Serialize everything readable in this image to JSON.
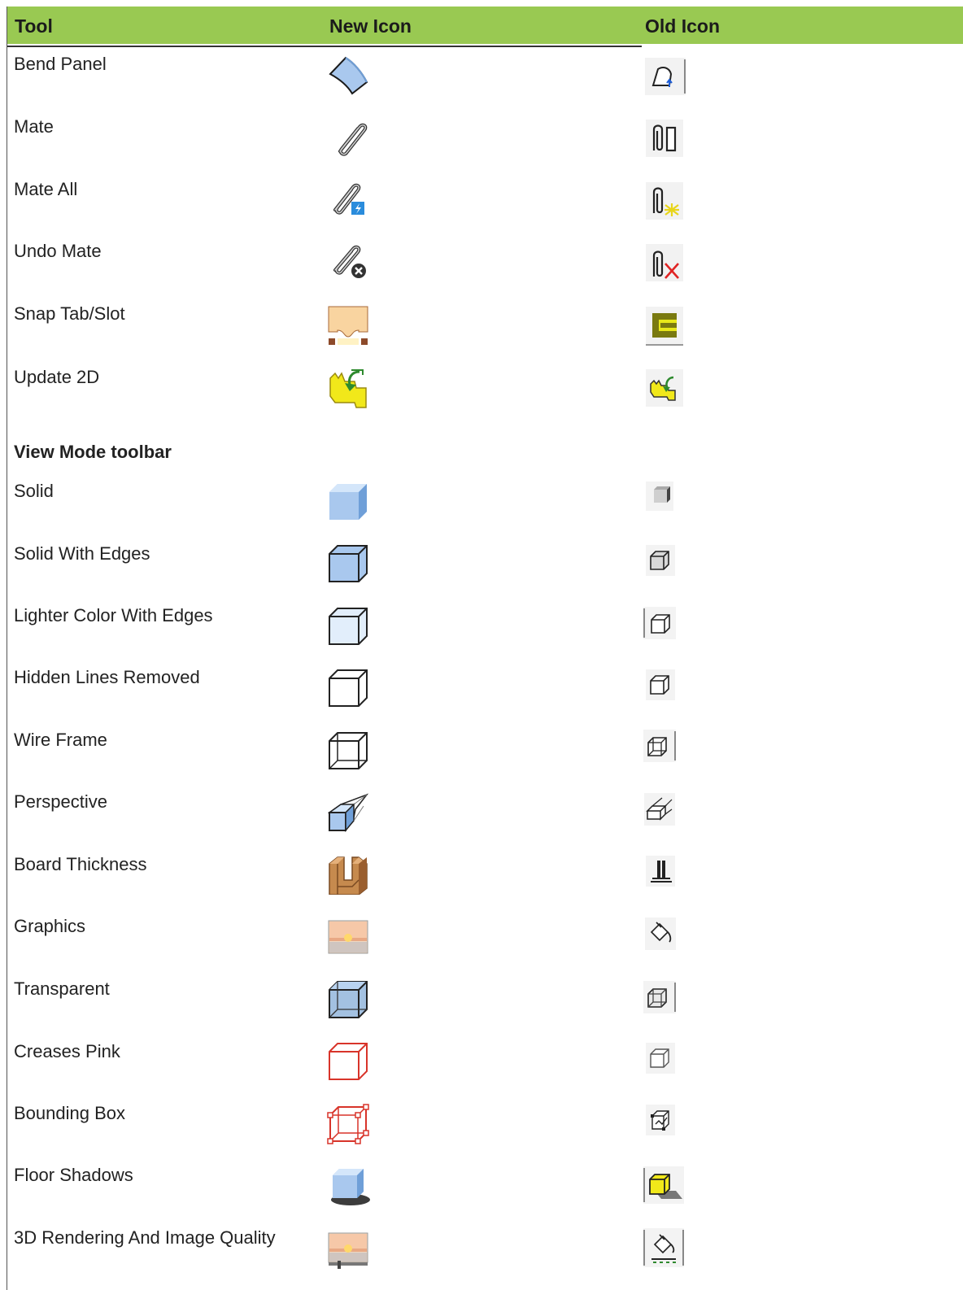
{
  "table": {
    "headers": {
      "tool": "Tool",
      "new_icon": "New Icon",
      "old_icon": "Old Icon"
    },
    "colors": {
      "header_bg": "#99c952",
      "accent_blue": "#a9c8ee",
      "edge_red": "#d8342a"
    },
    "rows": [
      {
        "label": "Bend Panel",
        "new_icon": "bend-panel-icon",
        "old_icon": "bend-panel-old-icon"
      },
      {
        "label": "Mate",
        "new_icon": "paperclip-icon",
        "old_icon": "mate-old-icon"
      },
      {
        "label": "Mate All",
        "new_icon": "paperclip-lightning-icon",
        "old_icon": "mate-all-old-icon"
      },
      {
        "label": "Undo Mate",
        "new_icon": "paperclip-remove-icon",
        "old_icon": "undo-mate-old-icon"
      },
      {
        "label": "Snap Tab/Slot",
        "new_icon": "tab-slot-icon",
        "old_icon": "tab-slot-old-icon"
      },
      {
        "label": "Update 2D",
        "new_icon": "update-2d-icon",
        "old_icon": "update-2d-old-icon"
      }
    ],
    "section": {
      "label": "View Mode toolbar"
    },
    "view_rows": [
      {
        "label": "Solid",
        "new_icon": "solid-cube-icon",
        "old_icon": "solid-old-icon"
      },
      {
        "label": "Solid With Edges",
        "new_icon": "solid-edges-cube-icon",
        "old_icon": "solid-edges-old-icon"
      },
      {
        "label": "Lighter Color With Edges",
        "new_icon": "light-cube-icon",
        "old_icon": "light-old-icon"
      },
      {
        "label": "Hidden Lines Removed",
        "new_icon": "hidden-lines-cube-icon",
        "old_icon": "hidden-lines-old-icon"
      },
      {
        "label": "Wire Frame",
        "new_icon": "wireframe-cube-icon",
        "old_icon": "wireframe-old-icon"
      },
      {
        "label": "Perspective",
        "new_icon": "perspective-cube-icon",
        "old_icon": "perspective-old-icon"
      },
      {
        "label": "Board Thickness",
        "new_icon": "board-thickness-icon",
        "old_icon": "board-thickness-old-icon"
      },
      {
        "label": "Graphics",
        "new_icon": "graphics-icon",
        "old_icon": "paint-bucket-old-icon"
      },
      {
        "label": "Transparent",
        "new_icon": "transparent-cube-icon",
        "old_icon": "transparent-old-icon"
      },
      {
        "label": "Creases Pink",
        "new_icon": "creases-pink-cube-icon",
        "old_icon": "creases-pink-old-icon"
      },
      {
        "label": "Bounding Box",
        "new_icon": "bounding-box-icon",
        "old_icon": "bounding-box-old-icon"
      },
      {
        "label": "Floor Shadows",
        "new_icon": "floor-shadow-cube-icon",
        "old_icon": "floor-shadow-old-icon"
      },
      {
        "label": "3D Rendering And Image Quality",
        "new_icon": "render-quality-icon",
        "old_icon": "render-quality-old-icon"
      }
    ]
  }
}
